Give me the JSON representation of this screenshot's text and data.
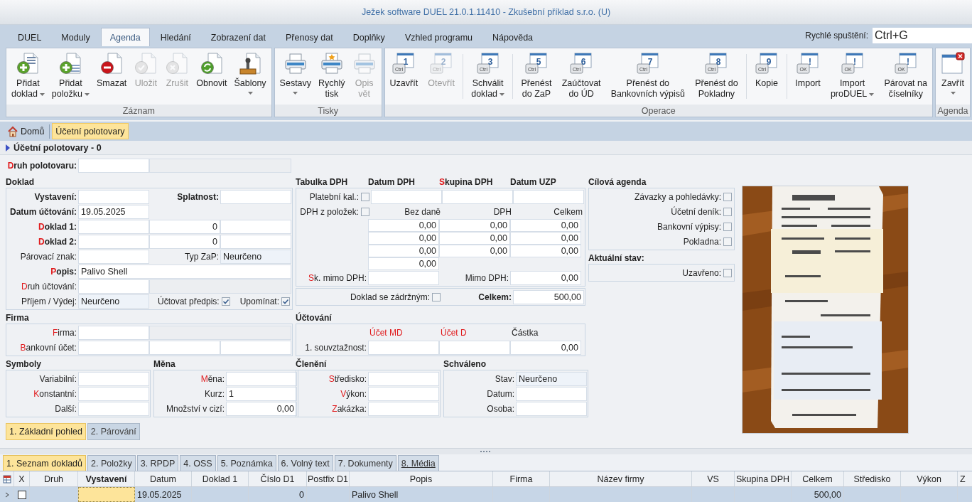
{
  "window": {
    "title": "Ježek software DUEL 21.0.1.11410 - Zkušební příklad s.r.o. (U)"
  },
  "menu_tabs": [
    {
      "label": "DUEL",
      "selected": false
    },
    {
      "label": "Moduly",
      "selected": false
    },
    {
      "label": "Agenda",
      "selected": true
    },
    {
      "label": "Hledání",
      "selected": false
    },
    {
      "label": "Zobrazení dat",
      "selected": false
    },
    {
      "label": "Přenosy dat",
      "selected": false
    },
    {
      "label": "Doplňky",
      "selected": false
    },
    {
      "label": "Vzhled programu",
      "selected": false
    },
    {
      "label": "Nápověda",
      "selected": false
    }
  ],
  "quick_launch": {
    "label": "Rychlé spuštění:",
    "value": "Ctrl+G"
  },
  "ribbon": [
    {
      "label": "Záznam",
      "buttons": [
        {
          "label": "Přidat\ndoklad",
          "kind": "add-doc",
          "disabled": false,
          "dropdown": true
        },
        {
          "label": "Přidat\npoložku",
          "kind": "add-item",
          "disabled": false,
          "dropdown": true
        },
        {
          "label": "Smazat",
          "kind": "delete",
          "disabled": false,
          "dropdown": false
        },
        {
          "label": "Uložit",
          "kind": "save",
          "disabled": true,
          "dropdown": false
        },
        {
          "label": "Zrušit",
          "kind": "cancel",
          "disabled": true,
          "dropdown": false
        },
        {
          "label": "Obnovit",
          "kind": "refresh",
          "disabled": false,
          "dropdown": false
        },
        {
          "label": "Šablony",
          "kind": "stamp",
          "disabled": false,
          "dropdown": true
        }
      ]
    },
    {
      "label": "Tisky",
      "buttons": [
        {
          "label": "Sestavy",
          "kind": "printer",
          "disabled": false,
          "dropdown": true
        },
        {
          "label": "Rychlý\ntisk",
          "kind": "printer-star",
          "disabled": false,
          "dropdown": false
        },
        {
          "label": "Opis\nvět",
          "kind": "printer",
          "disabled": true,
          "dropdown": false
        }
      ]
    },
    {
      "label": "Operace",
      "buttons": [
        {
          "label": "Uzavřít",
          "kind": "shortcut",
          "digit": "1",
          "key": "Ctrl",
          "disabled": false,
          "dropdown": false,
          "separator_before": false
        },
        {
          "label": "Otevřít",
          "kind": "shortcut",
          "digit": "2",
          "key": "Ctrl",
          "disabled": true,
          "dropdown": false,
          "separator_before": false
        },
        {
          "label": "Schválit\ndoklad",
          "kind": "shortcut",
          "digit": "3",
          "key": "Ctrl",
          "disabled": false,
          "dropdown": true,
          "separator_before": true
        },
        {
          "label": "Přenést\ndo ZaP",
          "kind": "shortcut",
          "digit": "5",
          "key": "Ctrl",
          "disabled": false,
          "dropdown": false,
          "separator_before": true
        },
        {
          "label": "Zaúčtovat\ndo ÚD",
          "kind": "shortcut",
          "digit": "6",
          "key": "Ctrl",
          "disabled": false,
          "dropdown": false,
          "separator_before": false
        },
        {
          "label": "Přenést do\nBankovních výpisů",
          "kind": "shortcut",
          "digit": "7",
          "key": "Ctrl",
          "disabled": false,
          "dropdown": false,
          "separator_before": false
        },
        {
          "label": "Přenést do\nPokladny",
          "kind": "shortcut",
          "digit": "8",
          "key": "Ctrl",
          "disabled": false,
          "dropdown": false,
          "separator_before": false
        },
        {
          "label": "Kopie",
          "kind": "shortcut",
          "digit": "9",
          "key": "Ctrl",
          "disabled": false,
          "dropdown": false,
          "separator_before": true
        },
        {
          "label": "Import",
          "kind": "ok",
          "digit": "!",
          "key": "OK",
          "disabled": false,
          "dropdown": false,
          "separator_before": true
        },
        {
          "label": "Import\nproDUEL",
          "kind": "ok",
          "digit": "!",
          "key": "OK",
          "disabled": false,
          "dropdown": true,
          "separator_before": false
        },
        {
          "label": "Párovat na\nčíselníky",
          "kind": "ok",
          "digit": "!",
          "key": "OK",
          "disabled": false,
          "dropdown": false,
          "separator_before": false
        }
      ]
    },
    {
      "label": "Agenda",
      "buttons": [
        {
          "label": "Zavřít",
          "kind": "close",
          "disabled": false,
          "dropdown": true
        }
      ]
    }
  ],
  "breadcrumbs": [
    {
      "label": "Domů",
      "kind": "home",
      "selected": false
    },
    {
      "label": "Účetní polotovary",
      "kind": "page",
      "selected": true
    }
  ],
  "section_title": "Účetní polotovary - 0",
  "form": {
    "druh": [
      {
        "kind": "label",
        "text": "Druh polotovaru:",
        "bold": true,
        "red_initial": true
      },
      {
        "kind": "input"
      },
      {
        "kind": "static",
        "wide": true
      }
    ],
    "doklad": {
      "title": "Doklad",
      "rows": [
        [
          {
            "kind": "label",
            "text": "Vystavení:",
            "bold": true
          },
          {
            "kind": "input"
          },
          {
            "kind": "label",
            "text": "Splatnost:",
            "bold": true
          },
          {
            "kind": "input"
          }
        ],
        [
          {
            "kind": "label",
            "text": "Datum účtování:",
            "bold": true
          },
          {
            "kind": "input",
            "value": "19.05.2025"
          }
        ],
        [
          {
            "kind": "label",
            "text": "Doklad 1:",
            "bold": true,
            "red_initial": true
          },
          {
            "kind": "input"
          },
          {
            "kind": "number",
            "value": "0"
          },
          {
            "kind": "input"
          }
        ],
        [
          {
            "kind": "label",
            "text": "Doklad 2:",
            "bold": true,
            "red_initial": true
          },
          {
            "kind": "input"
          },
          {
            "kind": "number",
            "value": "0"
          },
          {
            "kind": "input"
          }
        ],
        [
          {
            "kind": "label",
            "text": "Párovací znak:"
          },
          {
            "kind": "input"
          },
          {
            "kind": "label",
            "text": "Typ ZaP:"
          },
          {
            "kind": "combo",
            "value": "Neurčeno"
          }
        ],
        [
          {
            "kind": "label",
            "text": "Popis:",
            "bold": true,
            "red_initial": true
          },
          {
            "kind": "input",
            "value": "Palivo Shell",
            "wide": true
          }
        ],
        [
          {
            "kind": "label",
            "text": "Druh účtování:",
            "red_initial": true
          },
          {
            "kind": "input"
          },
          {
            "kind": "static",
            "wide": true
          }
        ],
        [
          {
            "kind": "label",
            "text": "Příjem / Výdej:"
          },
          {
            "kind": "combo",
            "value": "Neurčeno"
          },
          {
            "kind": "check",
            "text": "Účtovat předpis:",
            "checked": true
          },
          {
            "kind": "check",
            "text": "Upomínat:",
            "checked": true
          }
        ]
      ]
    },
    "dph": {
      "title": "Tabulka DPH",
      "heads": [
        {
          "text": "Datum DPH"
        },
        {
          "text": "Skupina DPH",
          "red_initial": true
        },
        {
          "text": "Datum UZP"
        }
      ],
      "rows": [
        [
          {
            "kind": "check",
            "text": "Platební kal.:",
            "checked": false
          },
          {
            "kind": "input"
          },
          {
            "kind": "input"
          },
          {
            "kind": "input"
          }
        ],
        [
          {
            "kind": "check",
            "text": "DPH z položek:",
            "checked": false
          },
          {
            "kind": "headr",
            "text": "Bez daně"
          },
          {
            "kind": "headr",
            "text": "DPH"
          },
          {
            "kind": "headr",
            "text": "Celkem"
          }
        ],
        [
          {
            "kind": "gap"
          },
          {
            "kind": "number",
            "value": "0,00"
          },
          {
            "kind": "number",
            "value": "0,00"
          },
          {
            "kind": "number",
            "value": "0,00"
          }
        ],
        [
          {
            "kind": "gap"
          },
          {
            "kind": "number",
            "value": "0,00"
          },
          {
            "kind": "number",
            "value": "0,00"
          },
          {
            "kind": "number",
            "value": "0,00"
          }
        ],
        [
          {
            "kind": "gap"
          },
          {
            "kind": "number",
            "value": "0,00"
          },
          {
            "kind": "number",
            "value": "0,00"
          },
          {
            "kind": "number",
            "value": "0,00"
          }
        ],
        [
          {
            "kind": "gap"
          },
          {
            "kind": "number",
            "value": "0,00"
          }
        ],
        [
          {
            "kind": "label",
            "text": "Sk. mimo DPH:",
            "red_initial": true
          },
          {
            "kind": "input"
          },
          {
            "kind": "label",
            "text": "Mimo DPH:"
          },
          {
            "kind": "number",
            "value": "0,00"
          }
        ]
      ]
    },
    "total": {
      "rows": [
        [
          {
            "kind": "check",
            "text": "Doklad se zádržným:",
            "checked": false
          },
          {
            "kind": "label",
            "text": "Celkem:",
            "bold": true
          },
          {
            "kind": "number",
            "value": "500,00"
          }
        ]
      ]
    },
    "firma": {
      "title": "Firma",
      "rows": [
        [
          {
            "kind": "label",
            "text": "Firma:",
            "red_initial": true
          },
          {
            "kind": "input"
          },
          {
            "kind": "static",
            "wide": true
          }
        ],
        [
          {
            "kind": "label",
            "text": "Bankovní účet:",
            "red_initial": true
          },
          {
            "kind": "input"
          },
          {
            "kind": "input"
          },
          {
            "kind": "input"
          }
        ]
      ]
    },
    "ucetni": {
      "title": "Účtování",
      "rows": [
        [
          {
            "kind": "gap"
          },
          {
            "kind": "head",
            "text": "Účet MD",
            "red": true
          },
          {
            "kind": "head",
            "text": "Účet D",
            "red": true
          },
          {
            "kind": "head",
            "text": "Částka",
            "red": false
          }
        ],
        [
          {
            "kind": "label",
            "text": "1. souvztažnost:"
          },
          {
            "kind": "input"
          },
          {
            "kind": "input"
          },
          {
            "kind": "number",
            "value": "0,00"
          }
        ]
      ]
    },
    "symboly": {
      "title": "Symboly",
      "rows": [
        [
          {
            "kind": "label",
            "text": "Variabilní:"
          },
          {
            "kind": "input"
          }
        ],
        [
          {
            "kind": "label",
            "text": "Konstantní:",
            "red_initial": true
          },
          {
            "kind": "input"
          }
        ],
        [
          {
            "kind": "label",
            "text": "Další:"
          },
          {
            "kind": "input"
          }
        ]
      ]
    },
    "mena": {
      "title": "Měna",
      "rows": [
        [
          {
            "kind": "label",
            "text": "Měna:",
            "red_initial": true
          },
          {
            "kind": "input"
          }
        ],
        [
          {
            "kind": "label",
            "text": "Kurz:"
          },
          {
            "kind": "input",
            "value": "1"
          }
        ],
        [
          {
            "kind": "label",
            "text": "Množství v cizí:"
          },
          {
            "kind": "number",
            "value": "0,00"
          }
        ]
      ]
    },
    "cleneni": {
      "title": "Členění",
      "rows": [
        [
          {
            "kind": "label",
            "text": "Středisko:",
            "red_initial": true
          },
          {
            "kind": "input"
          }
        ],
        [
          {
            "kind": "label",
            "text": "Výkon:",
            "red_initial": true
          },
          {
            "kind": "input"
          }
        ],
        [
          {
            "kind": "label",
            "text": "Zakázka:",
            "red_initial": true
          },
          {
            "kind": "input"
          }
        ]
      ]
    },
    "schvaleno": {
      "title": "Schváleno",
      "rows": [
        [
          {
            "kind": "label",
            "text": "Stav:"
          },
          {
            "kind": "combo",
            "value": "Neurčeno"
          }
        ],
        [
          {
            "kind": "label",
            "text": "Datum:"
          },
          {
            "kind": "input"
          }
        ],
        [
          {
            "kind": "label",
            "text": "Osoba:"
          },
          {
            "kind": "input"
          }
        ]
      ]
    },
    "cilova": {
      "title": "Cílová agenda",
      "rows": [
        [
          {
            "kind": "check",
            "text": "Závazky a pohledávky:",
            "checked": false
          }
        ],
        [
          {
            "kind": "check",
            "text": "Účetní deník:",
            "checked": false
          }
        ],
        [
          {
            "kind": "check",
            "text": "Bankovní výpisy:",
            "checked": false
          }
        ],
        [
          {
            "kind": "check",
            "text": "Pokladna:",
            "checked": false
          }
        ]
      ]
    },
    "stav": {
      "title": "Aktuální stav:",
      "rows": [
        [
          {
            "kind": "check",
            "text": "Uzavřeno:",
            "checked": false
          }
        ]
      ]
    },
    "views": [
      {
        "label": "1. Základní pohled",
        "selected": true
      },
      {
        "label": "2. Párování",
        "selected": false
      }
    ]
  },
  "bottom_tabs": [
    {
      "label": "1. Seznam dokladů",
      "selected": true
    },
    {
      "label": "2. Položky",
      "selected": false
    },
    {
      "label": "3. RPDP",
      "selected": false
    },
    {
      "label": "4. OSS",
      "selected": false
    },
    {
      "label": "5. Poznámka",
      "selected": false
    },
    {
      "label": "6. Volný text",
      "selected": false
    },
    {
      "label": "7. Dokumenty",
      "selected": false
    },
    {
      "label": "8. Média",
      "selected": false,
      "link": true
    }
  ],
  "table": {
    "columns": [
      {
        "label": "X"
      },
      {
        "label": "Druh"
      },
      {
        "label": "Vystavení"
      },
      {
        "label": "Datum"
      },
      {
        "label": "Doklad 1"
      },
      {
        "label": "Číslo D1",
        "kind": "number"
      },
      {
        "label": "Postfix D1"
      },
      {
        "label": "Popis"
      },
      {
        "label": "Firma"
      },
      {
        "label": "Název firmy"
      },
      {
        "label": "VS"
      },
      {
        "label": "Skupina DPH"
      },
      {
        "label": "Celkem",
        "kind": "number"
      },
      {
        "label": "Středisko"
      },
      {
        "label": "Výkon"
      },
      {
        "label": "Z"
      }
    ],
    "rows": [
      {
        "selected": true,
        "cells": [
          {
            "kind": "check",
            "checked": false,
            "focused": false
          },
          {
            "focused": false
          },
          {
            "focused": true
          },
          {
            "text": "19.05.2025",
            "focused": false
          },
          {
            "focused": false
          },
          {
            "text": "0",
            "focused": false
          },
          {
            "focused": false
          },
          {
            "text": "Palivo Shell",
            "focused": false
          },
          {
            "focused": false
          },
          {
            "focused": false
          },
          {
            "focused": false
          },
          {
            "focused": false
          },
          {
            "text": "500,00",
            "focused": false
          },
          {
            "focused": false
          },
          {
            "focused": false
          }
        ]
      }
    ]
  }
}
